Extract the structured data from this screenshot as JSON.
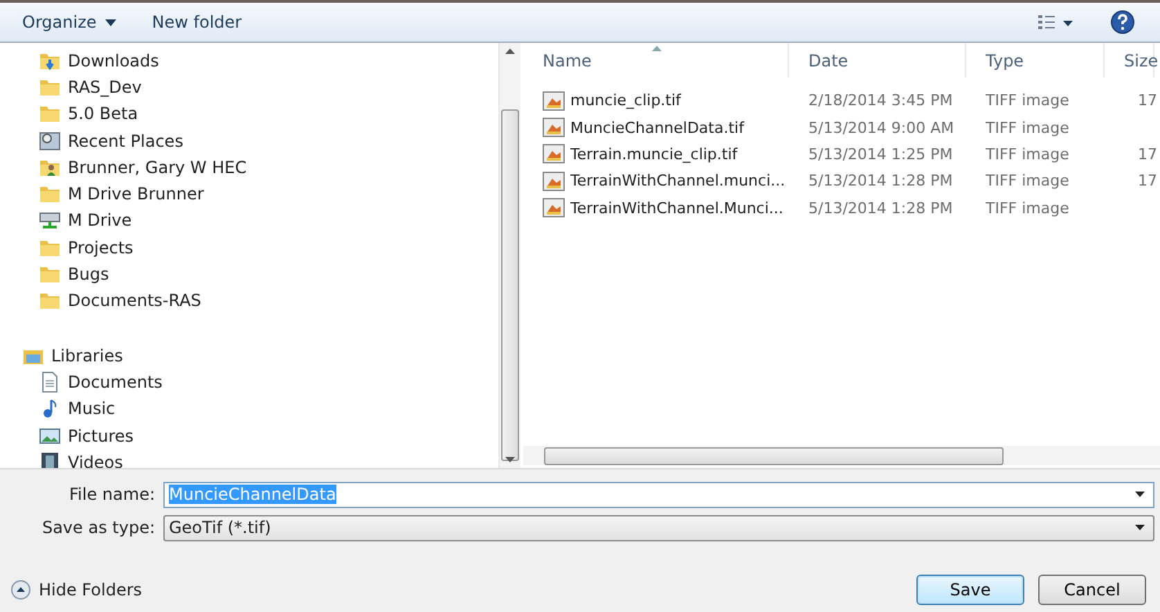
{
  "toolbar": {
    "buttons": [
      {
        "label": "Organize",
        "kind": "menu"
      },
      {
        "label": "New folder",
        "kind": "plain"
      }
    ]
  },
  "navigation": {
    "items": [
      {
        "label": "Downloads",
        "kind": "downloads"
      },
      {
        "label": "RAS_Dev",
        "kind": "folder"
      },
      {
        "label": "5.0 Beta",
        "kind": "folder"
      },
      {
        "label": "Recent Places",
        "kind": "recent"
      },
      {
        "label": "Brunner, Gary W HEC",
        "kind": "user"
      },
      {
        "label": "M Drive Brunner",
        "kind": "folder"
      },
      {
        "label": "M Drive",
        "kind": "network"
      },
      {
        "label": "Projects",
        "kind": "folder"
      },
      {
        "label": "Bugs",
        "kind": "folder"
      },
      {
        "label": "Documents-RAS",
        "kind": "folder"
      },
      {
        "label": "Libraries",
        "kind": "library",
        "children": [
          {
            "label": "Documents",
            "kind": "documents"
          },
          {
            "label": "Music",
            "kind": "music"
          },
          {
            "label": "Pictures",
            "kind": "pictures"
          },
          {
            "label": "Videos",
            "kind": "videos"
          }
        ]
      }
    ]
  },
  "file_list": {
    "columns": [
      {
        "label": "Name",
        "sorted": true
      },
      {
        "label": "Date",
        "sorted": false
      },
      {
        "label": "Type",
        "sorted": false
      },
      {
        "label": "Size",
        "sorted": false
      }
    ],
    "rows": [
      {
        "name": "muncie_clip.tif",
        "date": "2/18/2014 3:45 PM",
        "type": "TIFF image",
        "size": "17"
      },
      {
        "name": "MuncieChannelData.tif",
        "date": "5/13/2014 9:00 AM",
        "type": "TIFF image"
      },
      {
        "name": "Terrain.muncie_clip.tif",
        "date": "5/13/2014 1:25 PM",
        "type": "TIFF image",
        "size": "17"
      },
      {
        "name": "TerrainWithChannel.munci...",
        "date": "5/13/2014 1:28 PM",
        "type": "TIFF image",
        "size": "17"
      },
      {
        "name": "TerrainWithChannel.Munci...",
        "date": "5/13/2014 1:28 PM",
        "type": "TIFF image"
      }
    ]
  },
  "save_panel": {
    "file_name": {
      "label": "File name:",
      "value": "MuncieChannelData",
      "text_selected": true
    },
    "save_as_type": {
      "label": "Save as type:",
      "value": "GeoTif (*.tif)"
    },
    "hide_folders": "Hide Folders",
    "buttons": [
      {
        "label": "Save",
        "default": true
      },
      {
        "label": "Cancel",
        "default": false
      }
    ]
  }
}
